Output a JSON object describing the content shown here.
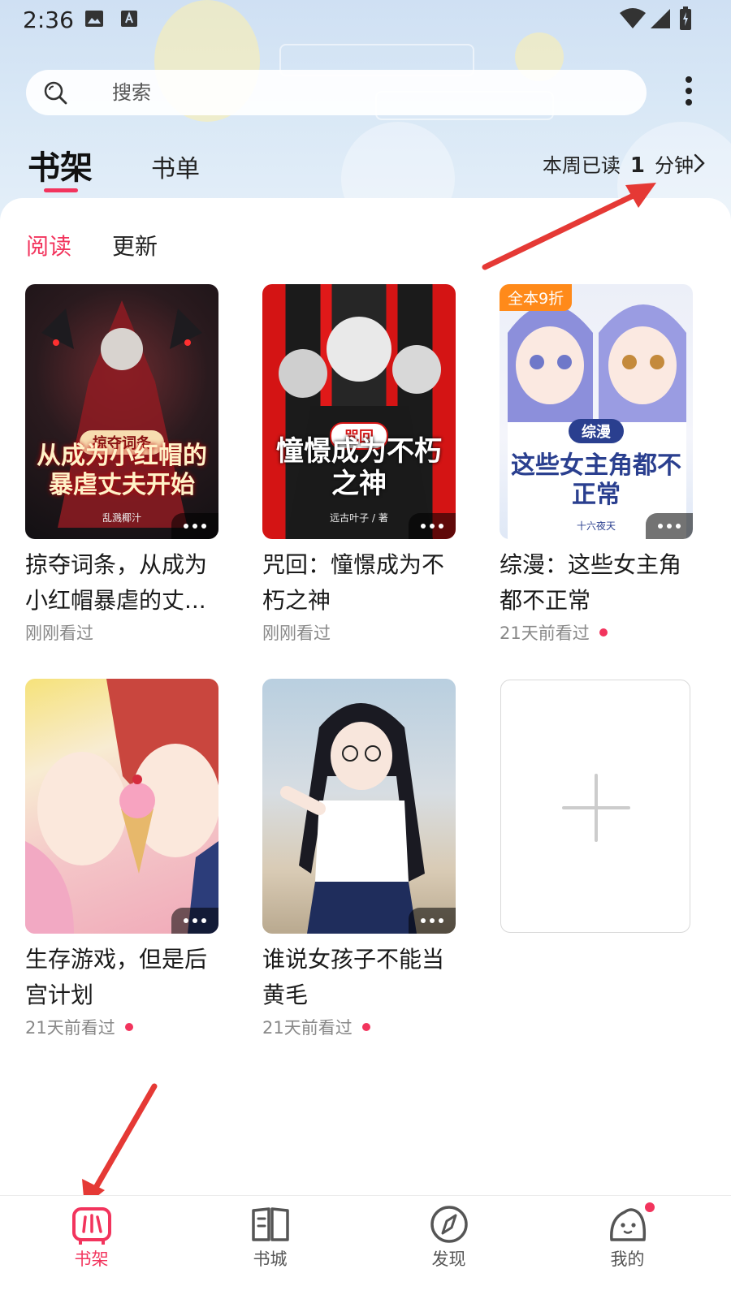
{
  "status_bar": {
    "time": "2:36"
  },
  "search": {
    "placeholder": "搜索"
  },
  "header": {
    "tabs": [
      "书架",
      "书单"
    ],
    "weekly_prefix": "本周已读",
    "weekly_value": "1",
    "weekly_unit": "分钟"
  },
  "sub_tabs": [
    "阅读",
    "更新"
  ],
  "books": [
    {
      "title": "掠夺词条，从成为小红帽暴虐的丈...",
      "status": "刚刚看过",
      "has_update": false,
      "cover_tag": "掠夺词条",
      "cover_title": "从成为小红帽的暴虐丈夫开始",
      "cover_author": "乱溅椰汁"
    },
    {
      "title": "咒回：憧憬成为不朽之神",
      "status": "刚刚看过",
      "has_update": false,
      "cover_tag": "咒回",
      "cover_title": "憧憬成为不朽之神",
      "cover_author": "远古叶子 / 著"
    },
    {
      "title": "综漫：这些女主角都不正常",
      "status": "21天前看过",
      "has_update": true,
      "promo": "全本9折",
      "cover_tag": "综漫",
      "cover_title": "这些女主角都不正常",
      "cover_author": "十六夜天"
    },
    {
      "title": "生存游戏，但是后宫计划",
      "status": "21天前看过",
      "has_update": true
    },
    {
      "title": "谁说女孩子不能当黄毛",
      "status": "21天前看过",
      "has_update": true
    }
  ],
  "bottom_nav": [
    {
      "label": "书架",
      "icon": "bookshelf-icon",
      "active": true
    },
    {
      "label": "书城",
      "icon": "book-store-icon",
      "active": false
    },
    {
      "label": "发现",
      "icon": "compass-icon",
      "active": false
    },
    {
      "label": "我的",
      "icon": "profile-icon",
      "active": false,
      "badge": true
    }
  ],
  "colors": {
    "accent": "#f2345d",
    "header_bg": "#d6e6f5",
    "promo": "#ff8a1a",
    "annotation_arrow": "#e53935"
  }
}
